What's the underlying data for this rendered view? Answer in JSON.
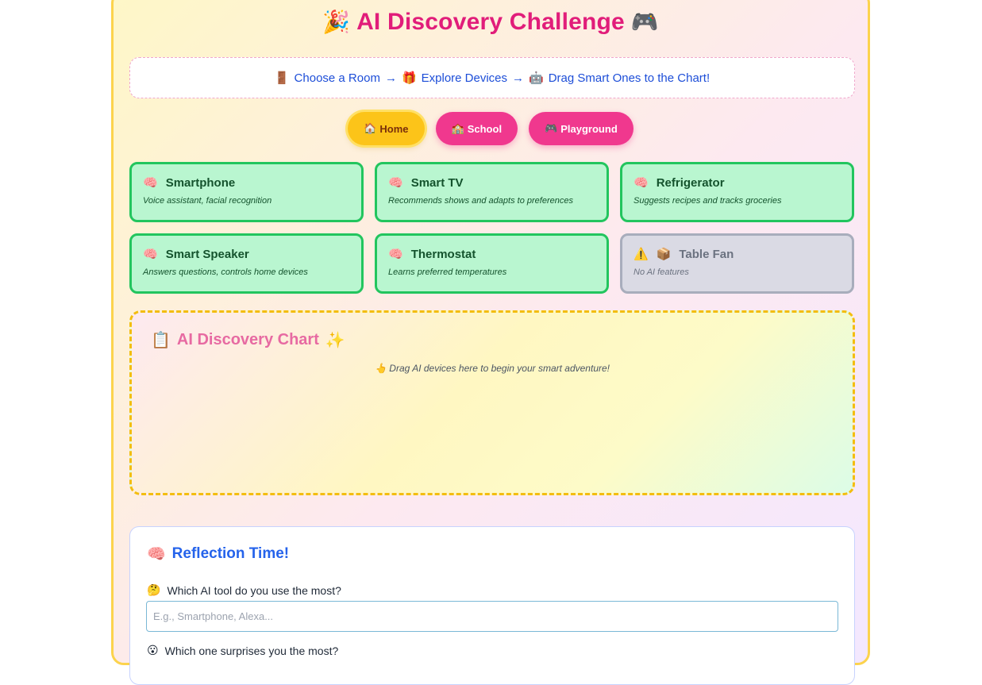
{
  "header": {
    "title": "AI Discovery Challenge",
    "icon_left": "🎉",
    "icon_right": "🎮"
  },
  "steps": [
    {
      "icon": "🚪",
      "text": "Choose a Room"
    },
    {
      "icon": "🎁",
      "text": "Explore Devices"
    },
    {
      "icon": "🤖",
      "text": "Drag Smart Ones to the Chart!"
    }
  ],
  "steps_arrow": "→",
  "rooms": [
    {
      "icon": "🏠",
      "label": "Home"
    },
    {
      "icon": "🏫",
      "label": "School"
    },
    {
      "icon": "🎮",
      "label": "Playground"
    }
  ],
  "devices": [
    {
      "icon": "🧠",
      "name": "Smartphone",
      "desc": "Voice assistant, facial recognition"
    },
    {
      "icon": "🧠",
      "name": "Smart TV",
      "desc": "Recommends shows and adapts to preferences"
    },
    {
      "icon": "🧠",
      "name": "Refrigerator",
      "desc": "Suggests recipes and tracks groceries"
    },
    {
      "icon": "🧠",
      "name": "Smart Speaker",
      "desc": "Answers questions, controls home devices"
    },
    {
      "icon": "🧠",
      "name": "Thermostat",
      "desc": "Learns preferred temperatures"
    },
    {
      "icon": "⚠️",
      "icon2": "📦",
      "name": "Table Fan",
      "desc": "No AI features"
    }
  ],
  "chart": {
    "icon": "📋",
    "title": "AI Discovery Chart",
    "sparkle": "✨",
    "hint_icon": "👆",
    "hint": "Drag AI devices here to begin your smart adventure!"
  },
  "reflection": {
    "icon": "🧠",
    "title": "Reflection Time!",
    "q1_icon": "🤔",
    "q1": "Which AI tool do you use the most?",
    "q1_placeholder": "E.g., Smartphone, Alexa...",
    "q2_icon": "😮",
    "q2": "Which one surprises you the most?"
  },
  "colors": {
    "accent_pink": "#e11d7a",
    "room_button": "#f0388e",
    "active_room": "#fcc419",
    "ai_card": "#b9f6d0",
    "ai_card_border": "#22c55e",
    "non_ai_card": "#dadae4",
    "link_blue": "#1d4ed8"
  }
}
